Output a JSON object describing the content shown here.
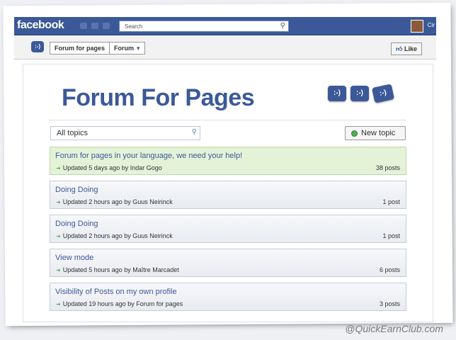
{
  "topbar": {
    "logo": "facebook",
    "search_placeholder": "Search",
    "user": "Cir"
  },
  "app_header": {
    "breadcrumb_app": "Forum for pages",
    "breadcrumb_section": "Forum",
    "like_label": "Like"
  },
  "main": {
    "title": "Forum For Pages",
    "bubble_glyph": ":-)",
    "filter_value": "All topics",
    "new_topic_label": "New topic",
    "topics": [
      {
        "title": "Forum for pages in your language, we need your help!",
        "meta": "Updated 5 days ago by Indar Gogo",
        "count": "38 posts",
        "highlight": true
      },
      {
        "title": "Doing Doing",
        "meta": "Updated 2 hours ago by Guus Neirinck",
        "count": "1 post",
        "highlight": false
      },
      {
        "title": "Doing Doing",
        "meta": "Updated 2 hours ago by Guus Neirinck",
        "count": "1 post",
        "highlight": false
      },
      {
        "title": "View mode",
        "meta": "Updated 5 hours ago by Maître Marcadet",
        "count": "6 posts",
        "highlight": false
      },
      {
        "title": "Visibility of Posts on my own profile",
        "meta": "Updated 19 hours ago by Forum for pages",
        "count": "3 posts",
        "highlight": false
      }
    ]
  },
  "watermark": "@QuickEarnClub.com",
  "colors": {
    "brand": "#3b5998",
    "highlight_row": "#e4f2d8",
    "status_green": "#4caf50"
  }
}
